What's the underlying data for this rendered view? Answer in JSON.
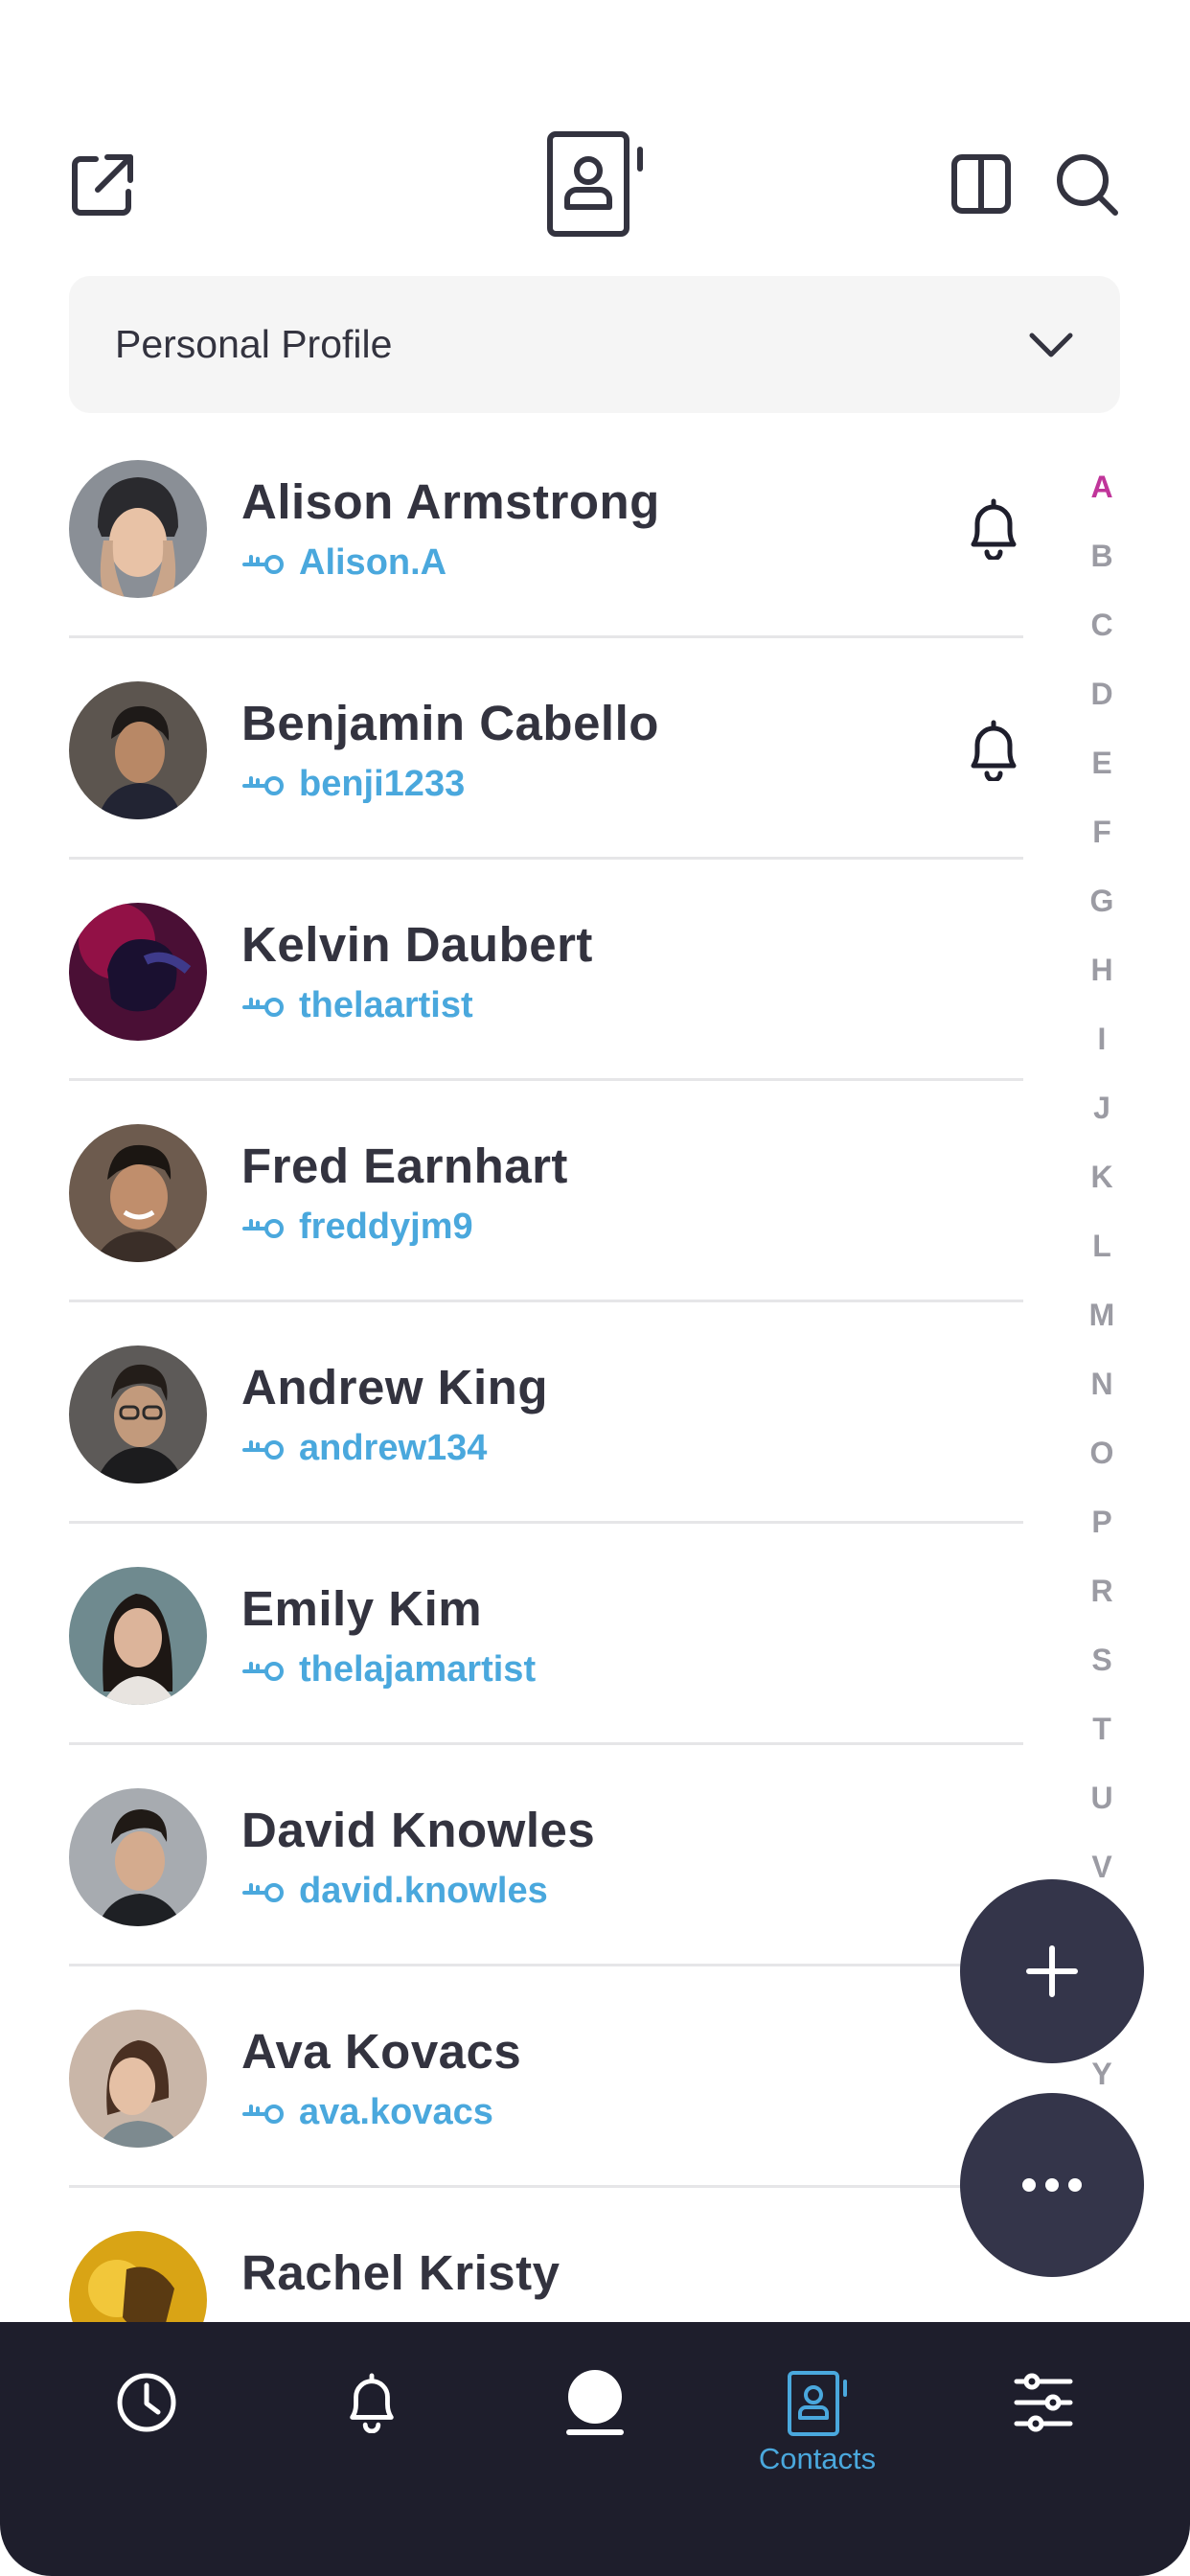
{
  "header": {
    "icons": [
      "share-icon",
      "contacts-book-icon",
      "split-view-icon",
      "search-icon"
    ]
  },
  "profile_selector": {
    "selected": "Personal Profile"
  },
  "contacts": [
    {
      "name": "Alison Armstrong",
      "handle": "Alison.A",
      "notifications": true
    },
    {
      "name": "Benjamin Cabello",
      "handle": "benji1233",
      "notifications": true
    },
    {
      "name": "Kelvin Daubert",
      "handle": "thelaartist",
      "notifications": false
    },
    {
      "name": "Fred Earnhart",
      "handle": "freddyjm9",
      "notifications": false
    },
    {
      "name": "Andrew King",
      "handle": "andrew134",
      "notifications": false
    },
    {
      "name": "Emily Kim",
      "handle": "thelajamartist",
      "notifications": false
    },
    {
      "name": "David Knowles",
      "handle": "david.knowles",
      "notifications": false
    },
    {
      "name": "Ava Kovacs",
      "handle": "ava.kovacs",
      "notifications": false
    },
    {
      "name": "Rachel Kristy",
      "handle": "",
      "notifications": false
    }
  ],
  "alphabet_index": {
    "letters": [
      "A",
      "B",
      "C",
      "D",
      "E",
      "F",
      "G",
      "H",
      "I",
      "J",
      "K",
      "L",
      "M",
      "N",
      "O",
      "P",
      "R",
      "S",
      "T",
      "U",
      "V",
      "Y"
    ],
    "active": "A"
  },
  "fab": {
    "add_icon": "plus-icon",
    "more_icon": "more-dots-icon"
  },
  "bottom_nav": {
    "items": [
      {
        "icon": "clock-icon",
        "label": ""
      },
      {
        "icon": "bell-icon",
        "label": ""
      },
      {
        "icon": "profile-icon",
        "label": ""
      },
      {
        "icon": "contacts-icon",
        "label": "Contacts",
        "active": true
      },
      {
        "icon": "sliders-icon",
        "label": ""
      }
    ]
  },
  "colors": {
    "text_dark": "#33333f",
    "accent_blue": "#4aa8dd",
    "accent_pink": "#c0359a",
    "nav_bg": "#1e1e2c",
    "fab_bg": "#34354a"
  }
}
